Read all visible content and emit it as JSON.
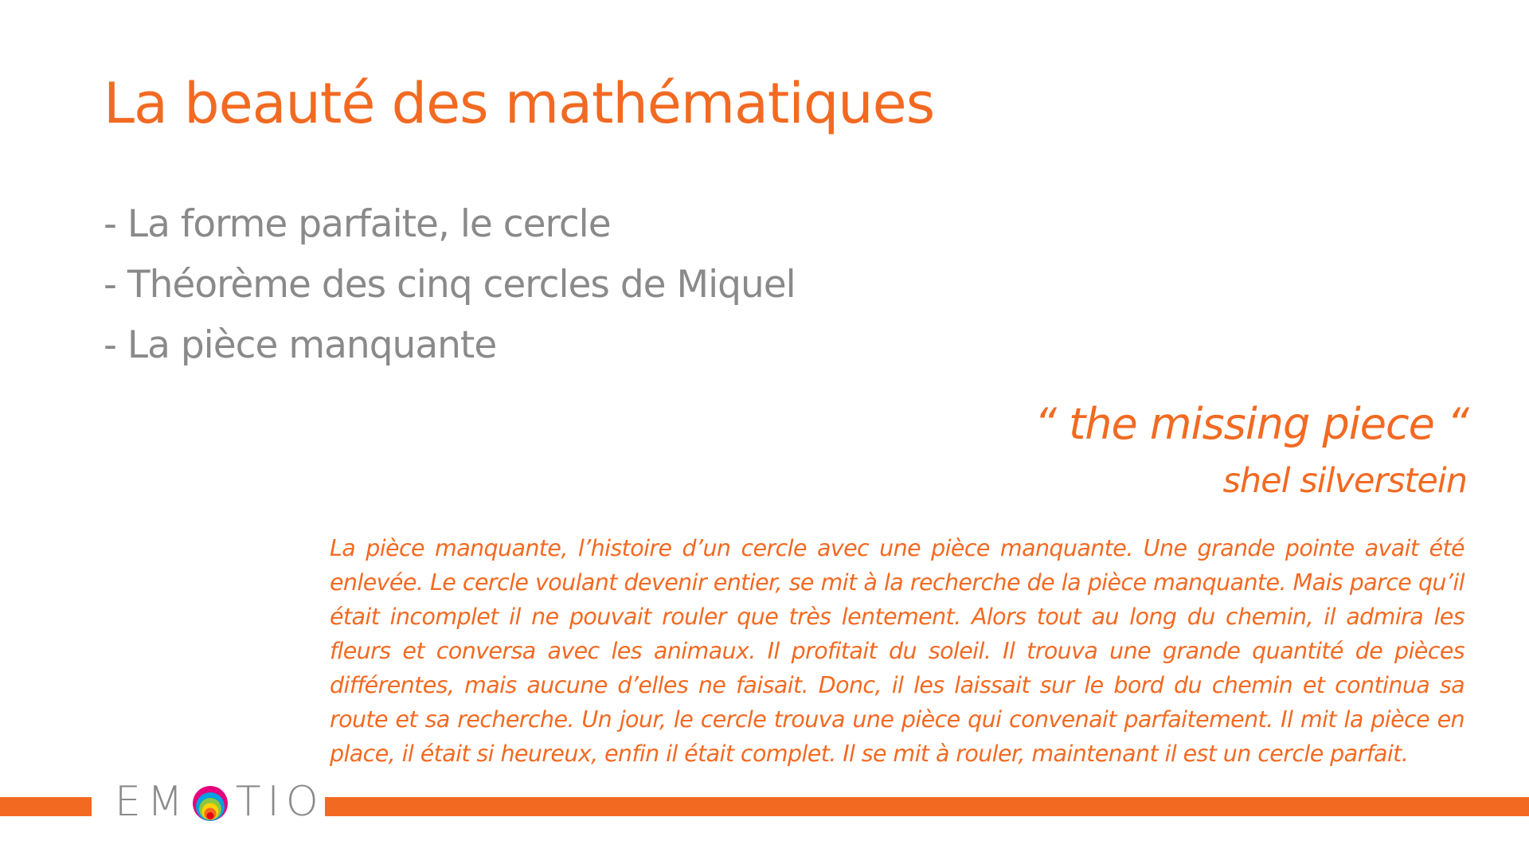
{
  "slide": {
    "title": "La beauté des mathématiques",
    "bullets": [
      "- La forme parfaite, le cercle",
      "- Théorème des cinq cercles de Miquel",
      "- La pièce manquante"
    ],
    "quote_title": "“ the missing piece “",
    "quote_author": "shel silverstein",
    "story": "La pièce manquante, l’histoire d’un cercle avec une pièce manquante.  Une grande pointe avait été enlevée.  Le cercle voulant devenir entier, se mit à la recherche de la pièce manquante.  Mais parce qu’il était incomplet il ne pouvait rouler que très lentement.  Alors tout au long du chemin, il admira les fleurs et conversa avec les animaux.  Il profitait du soleil.  Il trouva une grande quantité de pièces différentes, mais aucune d’elles ne faisait.  Donc, il les laissait sur le bord du chemin et continua sa route et sa recherche.  Un jour, le cercle trouva une pièce qui convenait parfaitement.  Il mit la pièce en place, il était si heureux, enfin il était complet.  Il se mit à rouler, maintenant il est un cercle parfait."
  },
  "logo": {
    "left_text": "EM",
    "right_text": "TIO",
    "ring_colors": [
      "#e6007e",
      "#00a0e3",
      "#8dc63f",
      "#ffd200",
      "#f26a22",
      "#e30613"
    ]
  },
  "colors": {
    "accent": "#f26a22",
    "bullet_text": "#8a8a8a",
    "background": "#ffffff"
  }
}
